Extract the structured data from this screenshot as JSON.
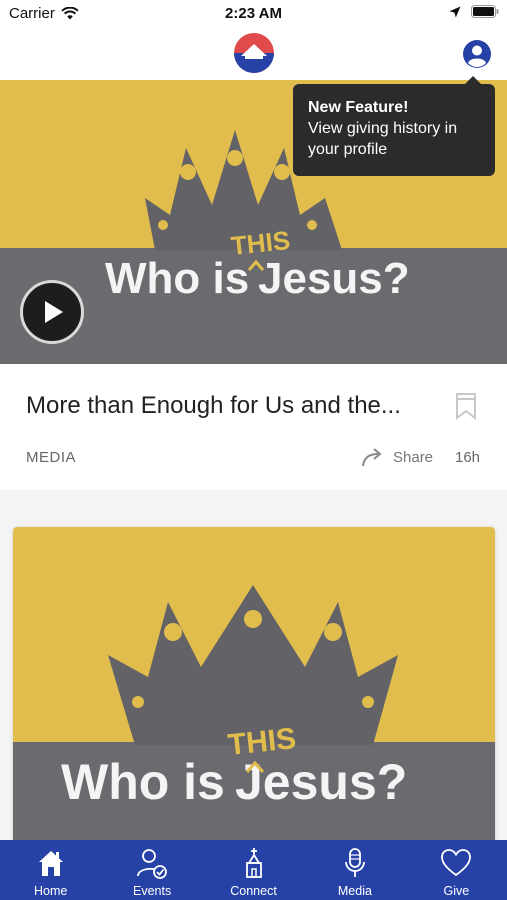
{
  "status_bar": {
    "carrier": "Carrier",
    "time": "2:23 AM"
  },
  "header": {
    "logo_icon": "church-logo-icon",
    "profile_icon": "profile-icon",
    "brand_colors": {
      "red": "#e04a4a",
      "blue": "#2742a7"
    }
  },
  "tooltip": {
    "title": "New Feature!",
    "body": "View giving history in your profile"
  },
  "feed": [
    {
      "art_line1": "Who is",
      "art_line2": "Jesus?",
      "art_accent": "THIS",
      "title": "More than Enough for Us and the...",
      "category": "MEDIA",
      "share_label": "Share",
      "time_ago": "16h"
    },
    {
      "art_line1": "Who is",
      "art_line2": "Jesus?",
      "art_accent": "THIS"
    }
  ],
  "tab_bar": {
    "items": [
      {
        "label": "Home",
        "icon": "home-icon"
      },
      {
        "label": "Events",
        "icon": "events-icon"
      },
      {
        "label": "Connect",
        "icon": "connect-icon"
      },
      {
        "label": "Media",
        "icon": "microphone-icon"
      },
      {
        "label": "Give",
        "icon": "heart-icon"
      }
    ],
    "background": "#2742a7"
  },
  "colors": {
    "art_yellow": "#e0bd4c",
    "art_gray": "#6b6a6e",
    "crown_gray": "#636267"
  }
}
